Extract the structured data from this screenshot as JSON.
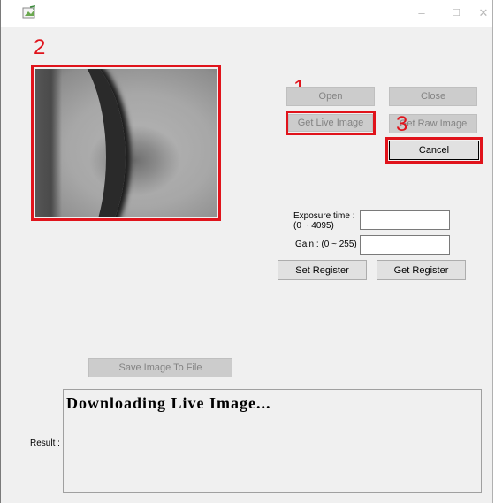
{
  "window": {
    "icon": "app-icon",
    "controls": {
      "minimize": "–",
      "maximize": "☐",
      "close": "✕"
    }
  },
  "annotations": {
    "marker_1": "1",
    "marker_2": "2",
    "marker_3": "3",
    "color": "#e0131b"
  },
  "buttons": {
    "open": "Open",
    "close": "Close",
    "get_live_image": "Get Live Image",
    "get_raw_image": "Get Raw Image",
    "cancel": "Cancel",
    "set_register": "Set Register",
    "get_register": "Get Register",
    "save_image": "Save Image To File"
  },
  "settings": {
    "exposure_label_line1": "Exposure time :",
    "exposure_label_line2": "(0 ~ 4095)",
    "exposure_value": "",
    "gain_label": "Gain : (0 ~ 255)",
    "gain_value": ""
  },
  "result": {
    "label": "Result :",
    "text": "Downloading Live Image..."
  }
}
